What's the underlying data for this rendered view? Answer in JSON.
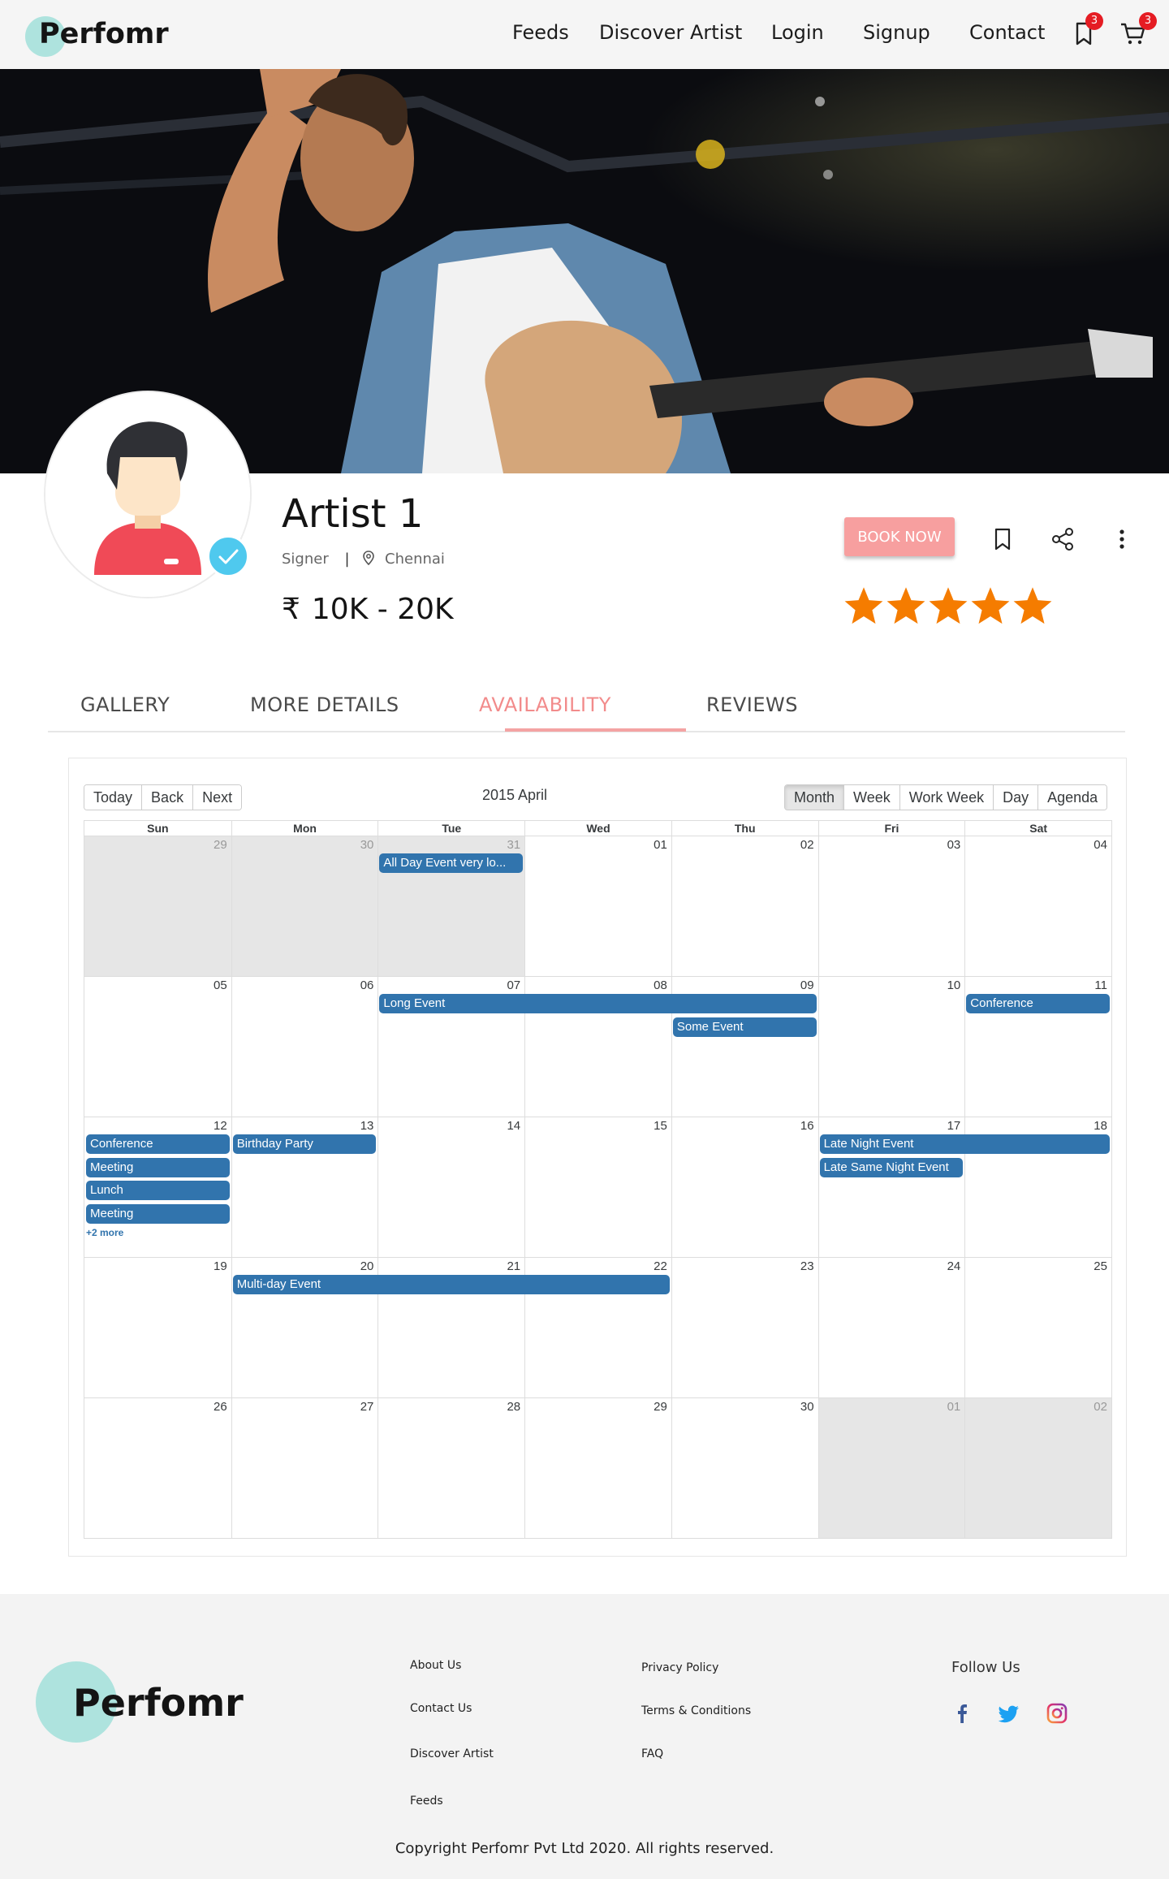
{
  "brand": {
    "name": "Perfomr"
  },
  "nav": {
    "links": [
      "Feeds",
      "Discover Artist",
      "Login",
      "Signup",
      "Contact"
    ],
    "bookmark_count": "3",
    "cart_count": "3"
  },
  "profile": {
    "name": "Artist 1",
    "category": "Signer",
    "separator": "|",
    "location": "Chennai",
    "currency_symbol": "₹",
    "price_range": "10K - 20K",
    "book_label": "BOOK NOW",
    "rating": 5,
    "rating_max": 5,
    "star_color": "#f57c00"
  },
  "tabs": {
    "items": [
      "GALLERY",
      "MORE DETAILS",
      "AVAILABILITY",
      "REVIEWS"
    ],
    "active": "AVAILABILITY"
  },
  "calendar": {
    "toolbar": {
      "nav_buttons": [
        "Today",
        "Back",
        "Next"
      ],
      "label": "2015 April",
      "view_buttons": [
        "Month",
        "Week",
        "Work Week",
        "Day",
        "Agenda"
      ],
      "active_view": "Month"
    },
    "weekdays": [
      "Sun",
      "Mon",
      "Tue",
      "Wed",
      "Thu",
      "Fri",
      "Sat"
    ],
    "weeks": [
      [
        {
          "d": "29",
          "off": true
        },
        {
          "d": "30",
          "off": true
        },
        {
          "d": "31",
          "off": true
        },
        {
          "d": "01"
        },
        {
          "d": "02"
        },
        {
          "d": "03"
        },
        {
          "d": "04"
        }
      ],
      [
        {
          "d": "05"
        },
        {
          "d": "06"
        },
        {
          "d": "07"
        },
        {
          "d": "08"
        },
        {
          "d": "09"
        },
        {
          "d": "10"
        },
        {
          "d": "11"
        }
      ],
      [
        {
          "d": "12"
        },
        {
          "d": "13"
        },
        {
          "d": "14"
        },
        {
          "d": "15"
        },
        {
          "d": "16"
        },
        {
          "d": "17"
        },
        {
          "d": "18"
        }
      ],
      [
        {
          "d": "19"
        },
        {
          "d": "20"
        },
        {
          "d": "21"
        },
        {
          "d": "22"
        },
        {
          "d": "23"
        },
        {
          "d": "24"
        },
        {
          "d": "25"
        }
      ],
      [
        {
          "d": "26"
        },
        {
          "d": "27"
        },
        {
          "d": "28"
        },
        {
          "d": "29"
        },
        {
          "d": "30"
        },
        {
          "d": "01",
          "off": true
        },
        {
          "d": "02",
          "off": true
        }
      ]
    ],
    "events": [
      {
        "title": "All Day Event very lo...",
        "week": 0,
        "start": 2,
        "span": 1,
        "slot": 0
      },
      {
        "title": "Long Event",
        "week": 1,
        "start": 2,
        "span": 3,
        "slot": 0
      },
      {
        "title": "Some Event",
        "week": 1,
        "start": 4,
        "span": 1,
        "slot": 1
      },
      {
        "title": "Conference",
        "week": 1,
        "start": 6,
        "span": 1,
        "slot": 0
      },
      {
        "title": "Conference",
        "week": 2,
        "start": 0,
        "span": 1,
        "slot": 0
      },
      {
        "title": "Meeting",
        "week": 2,
        "start": 0,
        "span": 1,
        "slot": 1
      },
      {
        "title": "Lunch",
        "week": 2,
        "start": 0,
        "span": 1,
        "slot": 2
      },
      {
        "title": "Meeting",
        "week": 2,
        "start": 0,
        "span": 1,
        "slot": 3
      },
      {
        "title": "Birthday Party",
        "week": 2,
        "start": 1,
        "span": 1,
        "slot": 0
      },
      {
        "title": "Late Night Event",
        "week": 2,
        "start": 5,
        "span": 2,
        "slot": 0
      },
      {
        "title": "Late Same Night Event",
        "week": 2,
        "start": 5,
        "span": 1,
        "slot": 1
      },
      {
        "title": "Multi-day Event",
        "week": 3,
        "start": 1,
        "span": 3,
        "slot": 0
      }
    ],
    "more": [
      {
        "label": "+2 more",
        "week": 2,
        "day": 0
      }
    ],
    "event_color": "#3174ad"
  },
  "footer": {
    "col1": [
      "About Us",
      "Contact Us",
      "Discover Artist",
      "Feeds"
    ],
    "col2": [
      "Privacy Policy",
      "Terms & Conditions",
      "FAQ"
    ],
    "follow_label": "Follow Us",
    "social": [
      "facebook-icon",
      "twitter-icon",
      "instagram-icon"
    ],
    "copyright": "Copyright Perfomr Pvt Ltd 2020. All rights reserved."
  }
}
